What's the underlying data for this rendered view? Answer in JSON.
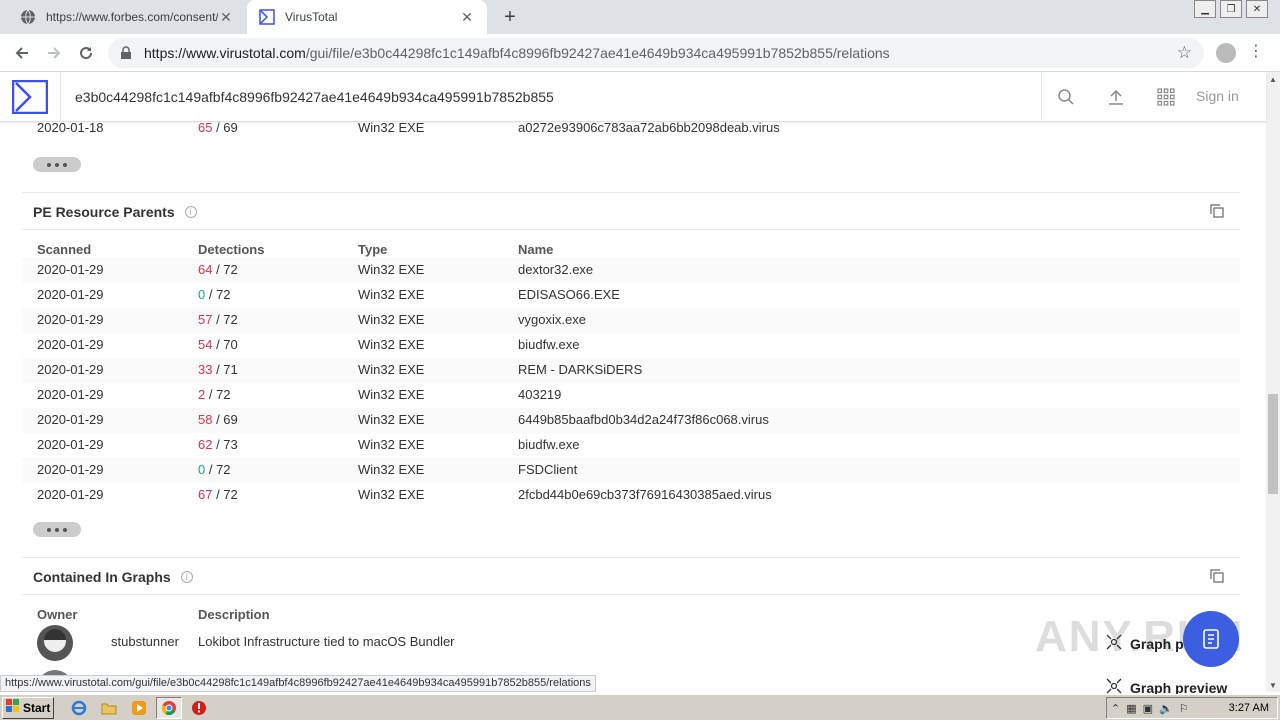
{
  "browser": {
    "tabs": [
      {
        "title": "https://www.forbes.com/consent/?t",
        "active": false
      },
      {
        "title": "VirusTotal",
        "active": true
      }
    ],
    "url_prefix": "https://www.virustotal.com",
    "url_path": "/gui/file/e3b0c44298fc1c149afbf4c8996fb92427ae41e4649b934ca495991b7852b855/relations"
  },
  "header": {
    "search_value": "e3b0c44298fc1c149afbf4c8996fb92427ae41e4649b934ca495991b7852b855",
    "signin_label": "Sign in"
  },
  "prev_section": {
    "last_row": {
      "scanned": "2020-01-18",
      "det_pos": "65",
      "det_total": " / 69",
      "type": "Win32 EXE",
      "name": "a0272e93906c783aa72ab6bb2098deab.virus"
    }
  },
  "pe_parents": {
    "title": "PE Resource Parents",
    "columns": [
      "Scanned",
      "Detections",
      "Type",
      "Name"
    ],
    "rows": [
      {
        "scanned": "2020-01-29",
        "det_pos": "64",
        "det_total": " / 72",
        "type": "Win32 EXE",
        "name": "dextor32.exe",
        "color": "red"
      },
      {
        "scanned": "2020-01-29",
        "det_pos": "0",
        "det_total": " / 72",
        "type": "Win32 EXE",
        "name": "EDISASO66.EXE",
        "color": "green"
      },
      {
        "scanned": "2020-01-29",
        "det_pos": "57",
        "det_total": " / 72",
        "type": "Win32 EXE",
        "name": "vygoxix.exe",
        "color": "red"
      },
      {
        "scanned": "2020-01-29",
        "det_pos": "54",
        "det_total": " / 70",
        "type": "Win32 EXE",
        "name": "biudfw.exe",
        "color": "red"
      },
      {
        "scanned": "2020-01-29",
        "det_pos": "33",
        "det_total": " / 71",
        "type": "Win32 EXE",
        "name": "REM - DARKSiDERS",
        "color": "red"
      },
      {
        "scanned": "2020-01-29",
        "det_pos": "2",
        "det_total": " / 72",
        "type": "Win32 EXE",
        "name": "403219",
        "color": "red"
      },
      {
        "scanned": "2020-01-29",
        "det_pos": "58",
        "det_total": " / 69",
        "type": "Win32 EXE",
        "name": "6449b85baafbd0b34d2a24f73f86c068.virus",
        "color": "red"
      },
      {
        "scanned": "2020-01-29",
        "det_pos": "62",
        "det_total": " / 73",
        "type": "Win32 EXE",
        "name": "biudfw.exe",
        "color": "red"
      },
      {
        "scanned": "2020-01-29",
        "det_pos": "0",
        "det_total": " / 72",
        "type": "Win32 EXE",
        "name": "FSDClient",
        "color": "green"
      },
      {
        "scanned": "2020-01-29",
        "det_pos": "67",
        "det_total": " / 72",
        "type": "Win32 EXE",
        "name": "2fcbd44b0e69cb373f76916430385aed.virus",
        "color": "red"
      }
    ]
  },
  "graphs": {
    "title": "Contained In Graphs",
    "columns": [
      "Owner",
      "Description"
    ],
    "rows": [
      {
        "owner": "stubstunner",
        "description": "Lokibot Infrastructure tied to macOS Bundler"
      }
    ],
    "graph_preview_label": "Graph preview",
    "graph_preview_label_cut": "Graph p"
  },
  "watermark": "ANY.RUN",
  "status_url": "https://www.virustotal.com/gui/file/e3b0c44298fc1c149afbf4c8996fb92427ae41e4649b934ca495991b7852b855/relations",
  "taskbar": {
    "start_label": "Start",
    "clock": "3:27 AM"
  },
  "colors": {
    "detection_positive": "#e0314b",
    "detection_clean": "#1ea38c",
    "vt_brand": "#394eff"
  }
}
